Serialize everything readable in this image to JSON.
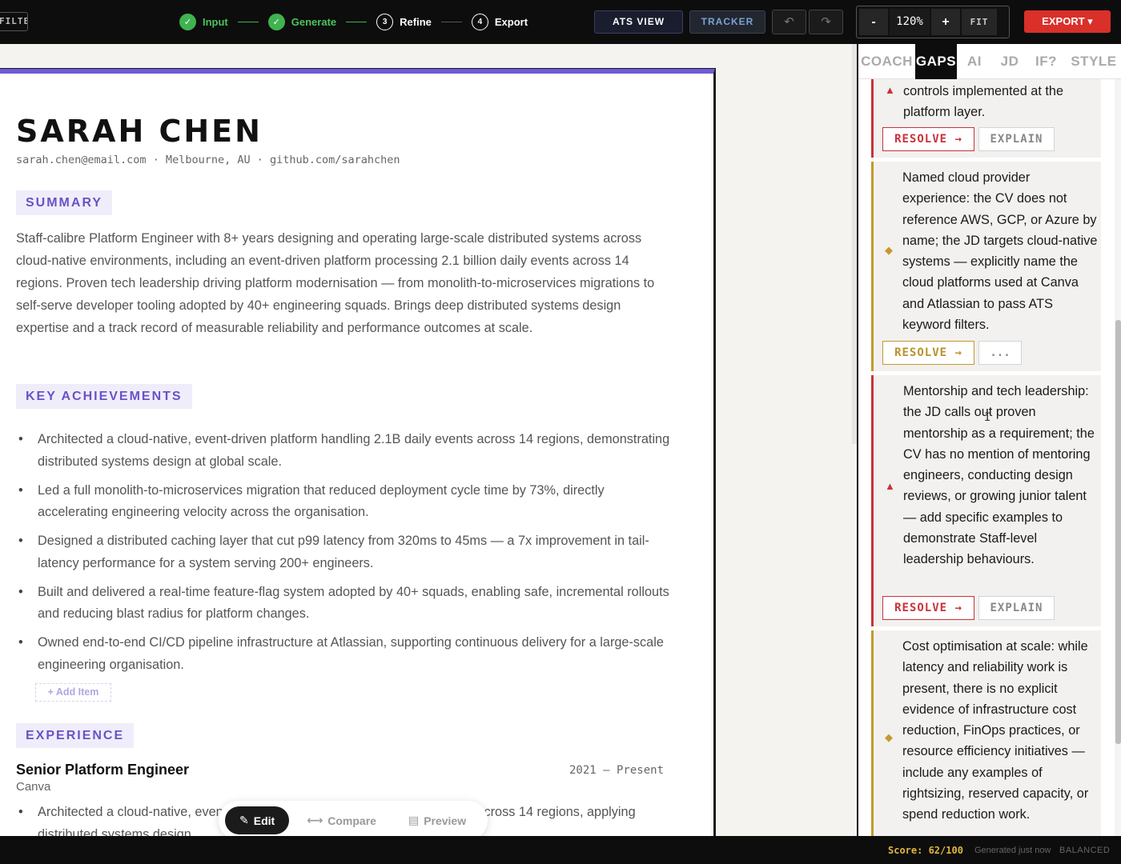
{
  "topbar": {
    "filter_label": "FILTER",
    "steps": [
      {
        "num": "✓",
        "label": "Input",
        "state": "done"
      },
      {
        "num": "✓",
        "label": "Generate",
        "state": "done"
      },
      {
        "num": "3",
        "label": "Refine",
        "state": "todo"
      },
      {
        "num": "4",
        "label": "Export",
        "state": "todo"
      }
    ],
    "ats_view_label": "ATS VIEW",
    "tracker_label": "TRACKER",
    "undo_icon": "↶",
    "redo_icon": "↷",
    "zoom_minus": "-",
    "zoom_value": "120%",
    "zoom_plus": "+",
    "zoom_fit": "FIT",
    "export_label": "EXPORT ▾"
  },
  "resume": {
    "name": "SARAH CHEN",
    "contact": "sarah.chen@email.com · Melbourne, AU · github.com/sarahchen",
    "summary_heading": "SUMMARY",
    "summary": "Staff-calibre Platform Engineer with 8+ years designing and operating large-scale distributed systems across cloud-native environments, including an event-driven platform processing 2.1 billion daily events across 14 regions. Proven tech leadership driving platform modernisation — from monolith-to-microservices migrations to self-serve developer tooling adopted by 40+ engineering squads. Brings deep distributed systems design expertise and a track record of measurable reliability and performance outcomes at scale.",
    "achievements_heading": "KEY ACHIEVEMENTS",
    "achievements": [
      "Architected a cloud-native, event-driven platform handling 2.1B daily events across 14 regions, demonstrating distributed systems design at global scale.",
      "Led a full monolith-to-microservices migration that reduced deployment cycle time by 73%, directly accelerating engineering velocity across the organisation.",
      "Designed a distributed caching layer that cut p99 latency from 320ms to 45ms — a 7x improvement in tail-latency performance for a system serving 200+ engineers.",
      "Built and delivered a real-time feature-flag system adopted by 40+ squads, enabling safe, incremental rollouts and reducing blast radius for platform changes.",
      "Owned end-to-end CI/CD pipeline infrastructure at Atlassian, supporting continuous delivery for a large-scale engineering organisation."
    ],
    "add_item_label": "+ Add Item",
    "experience_heading": "EXPERIENCE",
    "job": {
      "title": "Senior Platform Engineer",
      "dates": "2021 – Present",
      "company": "Canva",
      "bullet": "Architected a cloud-native, event-driven platform handling 2.1B daily events across 14 regions, applying distributed systems design"
    }
  },
  "mode_toggle": {
    "edit_label": "Edit",
    "compare_label": "Compare",
    "preview_label": "Preview",
    "edit_icon": "✎",
    "compare_icon": "⟷",
    "preview_icon": "▤"
  },
  "panel": {
    "tabs": [
      "COACH",
      "GAPS",
      "AI",
      "JD",
      "IF?",
      "STYLE"
    ],
    "active_tab": "GAPS",
    "gaps": [
      {
        "severity": "red",
        "marker": "▲",
        "text": "controls implemented at the platform layer.",
        "resolve_label": "RESOLVE →",
        "secondary_label": "EXPLAIN"
      },
      {
        "severity": "amber",
        "marker": "◆",
        "text": "Named cloud provider experience: the CV does not reference AWS, GCP, or Azure by name; the JD targets cloud-native systems — explicitly name the cloud platforms used at Canva and Atlassian to pass ATS keyword filters.",
        "resolve_label": "RESOLVE →",
        "secondary_label": "..."
      },
      {
        "severity": "red",
        "marker": "▲",
        "text": "Mentorship and tech leadership: the JD calls out proven mentorship as a requirement; the CV has no mention of mentoring engineers, conducting design reviews, or growing junior talent — add specific examples to demonstrate Staff-level leadership behaviours.",
        "resolve_label": "RESOLVE →",
        "secondary_label": "EXPLAIN"
      },
      {
        "severity": "amber",
        "marker": "◆",
        "text": "Cost optimisation at scale: while latency and reliability work is present, there is no explicit evidence of infrastructure cost reduction, FinOps practices, or resource efficiency initiatives — include any examples of rightsizing, reserved capacity, or spend reduction work."
      }
    ]
  },
  "status": {
    "score": "Score: 62/100",
    "generated": "Generated just now",
    "mode": "BALANCED"
  },
  "colors": {
    "accent": "#6f5bd4",
    "danger": "#c8333a",
    "warning": "#c49a2e",
    "success": "#3fb34f",
    "export": "#d9302a"
  }
}
